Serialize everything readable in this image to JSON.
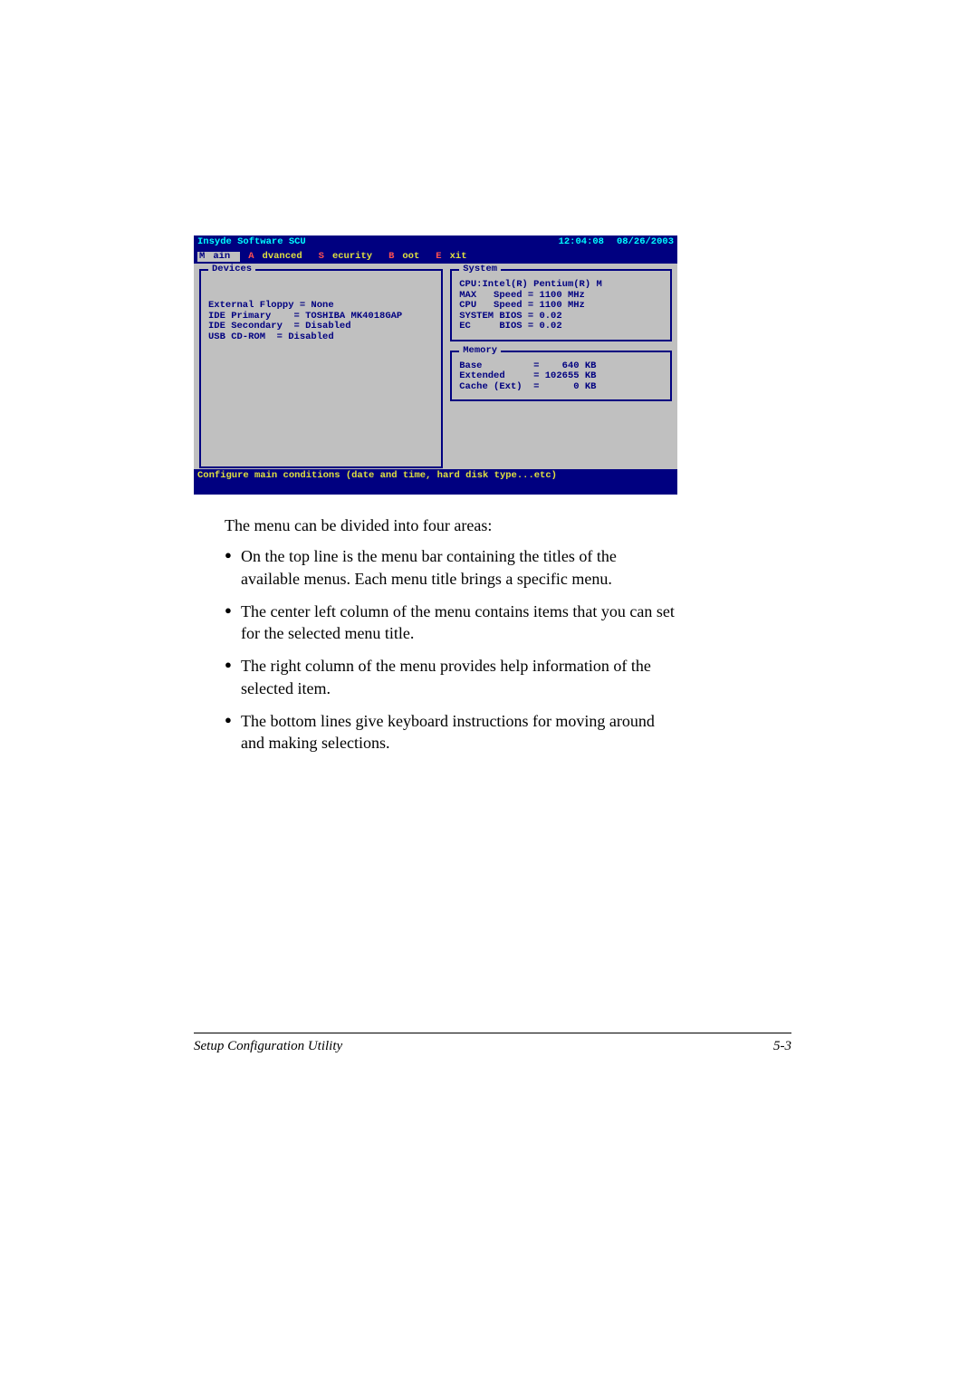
{
  "bios": {
    "title": "Insyde Software SCU",
    "time": "12:04:08",
    "date": "08/26/2003",
    "menu": {
      "main": "Main",
      "main_hot": "M",
      "main_rest": "ain",
      "advanced": "Advanced",
      "advanced_hot": "A",
      "advanced_rest": "dvanced",
      "security": "Security",
      "security_hot": "S",
      "security_rest": "ecurity",
      "boot": "Boot",
      "boot_hot": "B",
      "boot_rest": "oot",
      "exit": "Exit",
      "exit_hot": "E",
      "exit_rest": "xit"
    },
    "devices": {
      "legend": "Devices",
      "lines": "\n\nExternal Floppy = None\nIDE Primary    = TOSHIBA MK4018GAP\nIDE Secondary  = Disabled\nUSB CD-ROM  = Disabled"
    },
    "system": {
      "legend": "System",
      "lines": "CPU:Intel(R) Pentium(R) M\nMAX   Speed = 1100 MHz\nCPU   Speed = 1100 MHz\nSYSTEM BIOS = 0.02\nEC     BIOS = 0.02"
    },
    "memory": {
      "legend": "Memory",
      "lines": "Base         =    640 KB\nExtended     = 102655 KB\nCache (Ext)  =      0 KB"
    },
    "help": "Configure main conditions (date and time, hard disk type...etc)"
  },
  "doc": {
    "intro": "The menu can be divided into four areas:",
    "bullets": [
      "On the top line is the menu bar containing the titles of the available menus. Each menu title brings a specific menu.",
      "The center left column of the menu contains items that you can set for the selected menu title.",
      "The right column of the menu provides help information of the selected item.",
      "The bottom lines give keyboard instructions for moving around and making selections."
    ]
  },
  "footer": {
    "title": "Setup Configuration Utility",
    "page": "5-3"
  },
  "chart_data": {
    "type": "table",
    "title": "BIOS SCU Main screen values",
    "devices": {
      "External Floppy": "None",
      "IDE Primary": "TOSHIBA MK4018GAP",
      "IDE Secondary": "Disabled",
      "USB CD-ROM": "Disabled"
    },
    "system": {
      "CPU": "Intel(R) Pentium(R) M",
      "MAX Speed": "1100 MHz",
      "CPU Speed": "1100 MHz",
      "SYSTEM BIOS": "0.02",
      "EC BIOS": "0.02"
    },
    "memory": {
      "Base": "640 KB",
      "Extended": "102655 KB",
      "Cache (Ext)": "0 KB"
    },
    "timestamp": {
      "time": "12:04:08",
      "date": "08/26/2003"
    }
  }
}
